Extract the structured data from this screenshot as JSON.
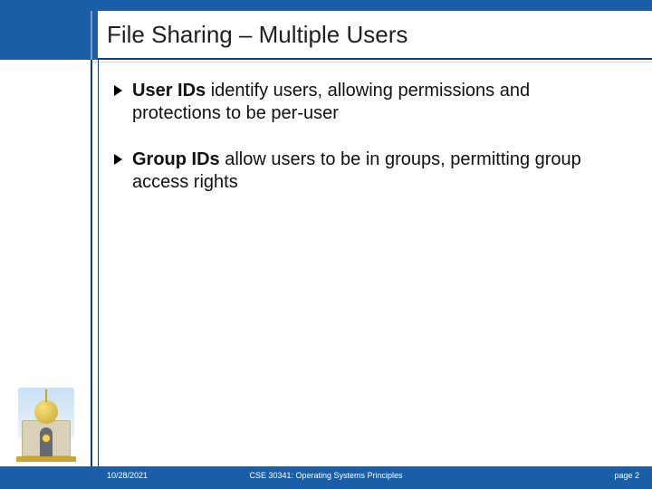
{
  "title": "File Sharing – Multiple Users",
  "bullets": [
    {
      "lead": "User IDs",
      "rest": " identify users, allowing permissions and protections to be per-user"
    },
    {
      "lead": "Group IDs",
      "rest": " allow users to be in groups, permitting group access rights"
    }
  ],
  "footer": {
    "date": "10/28/2021",
    "course": "CSE 30341: Operating Systems Principles",
    "page": "page 2"
  },
  "logo": {
    "name": "dome-logo"
  }
}
